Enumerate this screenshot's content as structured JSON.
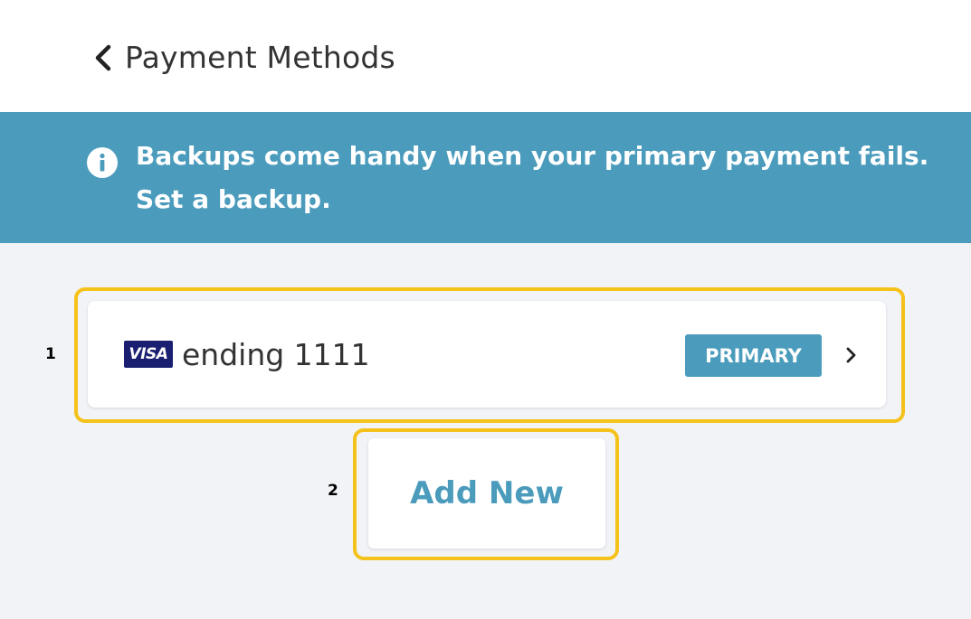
{
  "header": {
    "title": "Payment Methods",
    "back_icon": "chevron-left-icon"
  },
  "banner": {
    "icon": "info-icon",
    "line1": "Backups come handy when your primary payment fails.",
    "line2": "Set a backup.",
    "background": "#4a9bbc"
  },
  "payment_methods": [
    {
      "brand": "VISA",
      "label": "ending 1111",
      "badge": "PRIMARY",
      "chevron_icon": "chevron-right-icon"
    }
  ],
  "add_button": {
    "label": "Add New"
  },
  "annotations": {
    "marker_1": "1",
    "marker_2": "2"
  },
  "colors": {
    "accent": "#4a9bbc",
    "highlight": "#f5c21b",
    "visa": "#1a1f71"
  }
}
